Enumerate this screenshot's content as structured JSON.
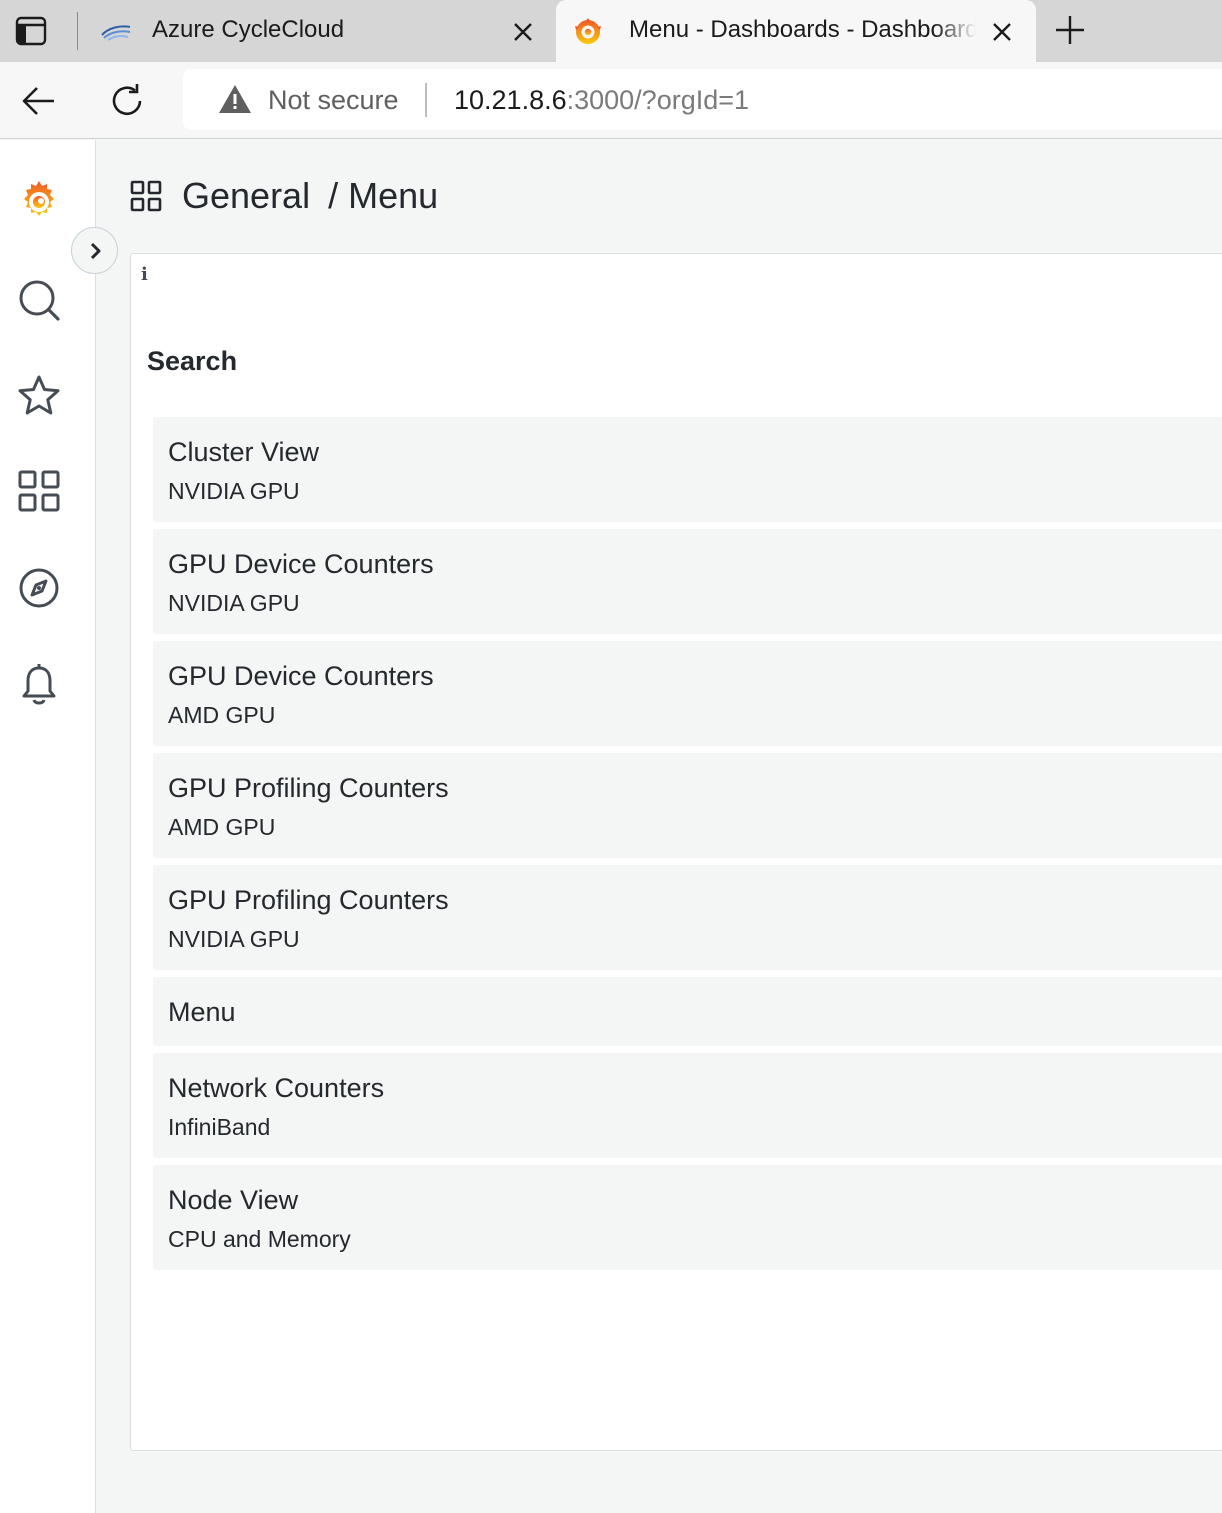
{
  "browser": {
    "tabs": [
      {
        "title": "Azure CycleCloud",
        "favicon": "azure-cyclecloud-icon",
        "active": false
      },
      {
        "title": "Menu - Dashboards - Dashboards",
        "favicon": "grafana-logo-icon",
        "active": true
      }
    ],
    "security_label": "Not secure",
    "url_host": "10.21.8.6",
    "url_rest": ":3000/?orgId=1"
  },
  "sidemenu": {
    "items": [
      "grafana-logo-icon",
      "search-icon",
      "star-icon",
      "dashboards-icon",
      "explore-icon",
      "alerting-bell-icon"
    ],
    "expand": "chevron-right-icon"
  },
  "header": {
    "folder": "General",
    "separator": "/",
    "title": "Menu"
  },
  "panel": {
    "info": "i",
    "heading": "Search",
    "dashboards": [
      {
        "title": "Cluster View",
        "tag": "NVIDIA GPU"
      },
      {
        "title": "GPU Device Counters",
        "tag": "NVIDIA GPU"
      },
      {
        "title": "GPU Device Counters",
        "tag": "AMD GPU"
      },
      {
        "title": "GPU Profiling Counters",
        "tag": "AMD GPU"
      },
      {
        "title": "GPU Profiling Counters",
        "tag": "NVIDIA GPU"
      },
      {
        "title": "Menu",
        "tag": ""
      },
      {
        "title": "Network Counters",
        "tag": "InfiniBand"
      },
      {
        "title": "Node View",
        "tag": "CPU and Memory"
      }
    ]
  },
  "colors": {
    "grafana_orange": "#f46800",
    "grafana_yellow": "#fbca0a",
    "page_bg": "#f4f5f5",
    "item_bg": "#f4f5f5"
  }
}
